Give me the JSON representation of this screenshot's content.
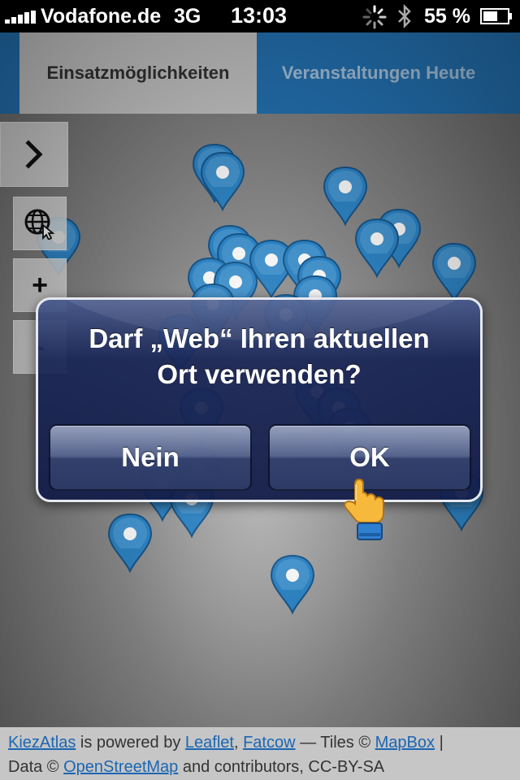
{
  "status_bar": {
    "carrier": "Vodafone.de",
    "network": "3G",
    "time": "13:03",
    "battery_percent": "55 %"
  },
  "tabs": [
    {
      "label": "Einsatzmöglichkeiten",
      "active": true
    },
    {
      "label": "Veranstaltungen Heute",
      "active": false
    }
  ],
  "map_controls": {
    "zoom_in": "+",
    "zoom_out": "-"
  },
  "alert": {
    "line1": "Darf „Web“ Ihren aktuellen",
    "line2": "Ort verwenden?",
    "cancel_label": "Nein",
    "ok_label": "OK"
  },
  "footer": {
    "kiezatlas": "KiezAtlas",
    "powered_by": " is powered by ",
    "leaflet": "Leaflet",
    "sep1": ", ",
    "fatcow": "Fatcow",
    "tiles": " — Tiles © ",
    "mapbox": "MapBox",
    "sep2": " |",
    "data": "Data © ",
    "osm": "OpenStreetMap",
    "contrib": " and contributors, CC-BY-SA"
  },
  "colors": {
    "tab_bar": "#2474b6",
    "marker": "#2e86c8",
    "alert_bg": "#1c2a5c",
    "link": "#1b66b3"
  }
}
